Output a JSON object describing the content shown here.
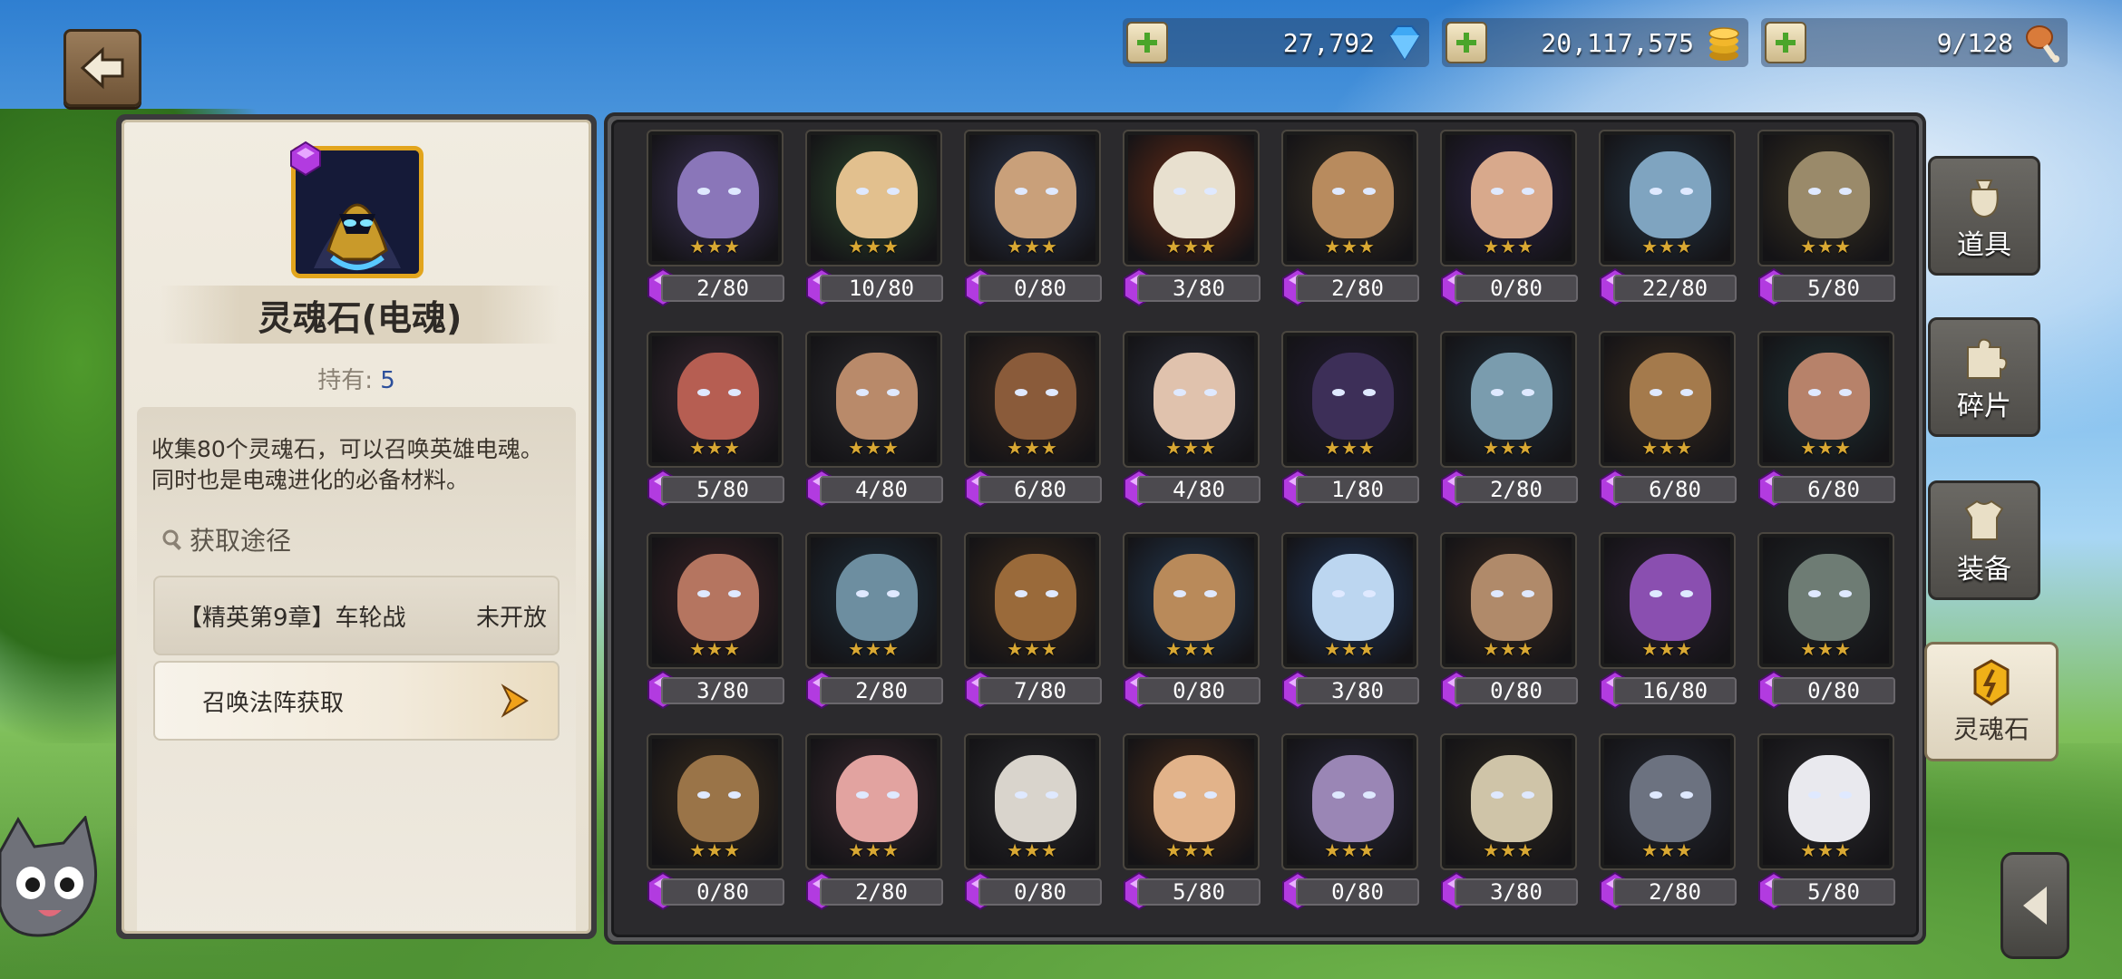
{
  "currency": [
    {
      "value": "27,792",
      "icon": "diamond-icon",
      "color": "#3fa9f5"
    },
    {
      "value": "20,117,575",
      "icon": "gold-coins-icon",
      "color": "#f2b72b"
    },
    {
      "value": "9/128",
      "icon": "drumstick-icon",
      "color": "#d97b3a"
    }
  ],
  "detail": {
    "title": "灵魂石(电魂)",
    "hold_label": "持有:",
    "hold_value": "5",
    "description": "收集80个灵魂石，可以召唤英雄电魂。同时也是电魂进化的必备材料。",
    "source_title": "获取途径",
    "sources": [
      {
        "label": "【精英第9章】车轮战",
        "status": "未开放"
      },
      {
        "label": "召唤法阵获取",
        "status": ""
      }
    ]
  },
  "tabs": [
    {
      "label": "道具",
      "icon": "bag-icon",
      "active": false
    },
    {
      "label": "碎片",
      "icon": "puzzle-piece-icon",
      "active": false
    },
    {
      "label": "装备",
      "icon": "armor-icon",
      "active": false
    },
    {
      "label": "灵魂石",
      "icon": "soulstone-icon",
      "active": true
    }
  ],
  "heroes": [
    {
      "count": "2/80",
      "bg": "#3c3357",
      "face": "#8a76b9",
      "stars": 3
    },
    {
      "count": "10/80",
      "bg": "#2d4a2e",
      "face": "#e2c08e",
      "stars": 3
    },
    {
      "count": "0/80",
      "bg": "#2e3950",
      "face": "#c9a07a",
      "stars": 3
    },
    {
      "count": "3/80",
      "bg": "#6a2d17",
      "face": "#e8e0cf",
      "stars": 3
    },
    {
      "count": "2/80",
      "bg": "#3a3225",
      "face": "#b88b5e",
      "stars": 3
    },
    {
      "count": "0/80",
      "bg": "#2d2446",
      "face": "#d8a98c",
      "stars": 3
    },
    {
      "count": "22/80",
      "bg": "#263746",
      "face": "#7fa4c0",
      "stars": 3
    },
    {
      "count": "5/80",
      "bg": "#3b3424",
      "face": "#9a8a6a",
      "stars": 3
    },
    {
      "count": "5/80",
      "bg": "#3a2a34",
      "face": "#b65e52",
      "stars": 3
    },
    {
      "count": "4/80",
      "bg": "#2c2c2f",
      "face": "#b98a6a",
      "stars": 3
    },
    {
      "count": "6/80",
      "bg": "#3a2a20",
      "face": "#8a5b3a",
      "stars": 3
    },
    {
      "count": "4/80",
      "bg": "#2b2f3a",
      "face": "#e0c2ad",
      "stars": 3
    },
    {
      "count": "1/80",
      "bg": "#231d33",
      "face": "#3d2f58",
      "stars": 3
    },
    {
      "count": "2/80",
      "bg": "#22303b",
      "face": "#7a9cae",
      "stars": 3
    },
    {
      "count": "6/80",
      "bg": "#3a2d20",
      "face": "#a47a4c",
      "stars": 3
    },
    {
      "count": "6/80",
      "bg": "#1f3336",
      "face": "#b7826a",
      "stars": 3
    },
    {
      "count": "3/80",
      "bg": "#3b2326",
      "face": "#b57560",
      "stars": 3
    },
    {
      "count": "2/80",
      "bg": "#1f2f3b",
      "face": "#6d8ea0",
      "stars": 3
    },
    {
      "count": "7/80",
      "bg": "#3a2b1d",
      "face": "#9a6a3a",
      "stars": 3
    },
    {
      "count": "0/80",
      "bg": "#243a52",
      "face": "#b98a5a",
      "stars": 3
    },
    {
      "count": "3/80",
      "bg": "#22385a",
      "face": "#bcd6f0",
      "stars": 3
    },
    {
      "count": "0/80",
      "bg": "#3b2c22",
      "face": "#b08a6a",
      "stars": 3
    },
    {
      "count": "16/80",
      "bg": "#2d2233",
      "face": "#8a4fb0",
      "stars": 3
    },
    {
      "count": "0/80",
      "bg": "#22282a",
      "face": "#6e7c74",
      "stars": 3
    },
    {
      "count": "0/80",
      "bg": "#3a2d1d",
      "face": "#9a7448",
      "stars": 3
    },
    {
      "count": "2/80",
      "bg": "#3b2a30",
      "face": "#e2a3a0",
      "stars": 3
    },
    {
      "count": "0/80",
      "bg": "#2b2b2d",
      "face": "#d9d4cc",
      "stars": 3
    },
    {
      "count": "5/80",
      "bg": "#4a2e1b",
      "face": "#e2b38a",
      "stars": 3
    },
    {
      "count": "0/80",
      "bg": "#2a2a3b",
      "face": "#9a86b5",
      "stars": 3
    },
    {
      "count": "3/80",
      "bg": "#2f2a21",
      "face": "#cfc4a8",
      "stars": 3
    },
    {
      "count": "2/80",
      "bg": "#262a33",
      "face": "#6c7280",
      "stars": 3
    },
    {
      "count": "5/80",
      "bg": "#2b2b2e",
      "face": "#e9e9ee",
      "stars": 3
    }
  ]
}
